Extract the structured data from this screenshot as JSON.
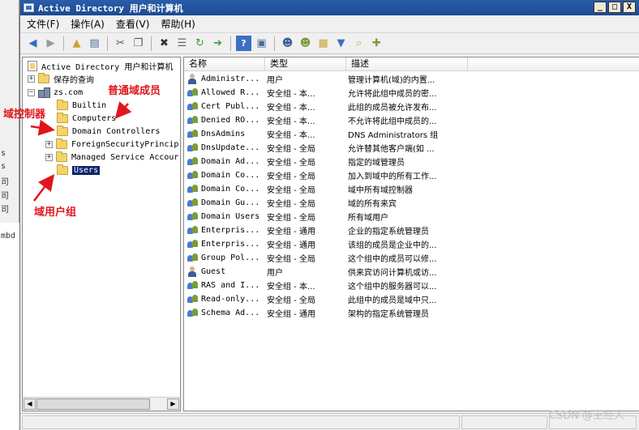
{
  "window": {
    "title": "Active Directory 用户和计算机",
    "min_label": "_",
    "max_label": "□",
    "close_label": "X"
  },
  "left_fragment": {
    "lines": [
      "s",
      "s",
      "司",
      "司",
      "司",
      "mbd"
    ]
  },
  "menu": {
    "items": [
      "文件(F)",
      "操作(A)",
      "查看(V)",
      "帮助(H)"
    ]
  },
  "toolbar": {
    "icons": [
      "back-icon",
      "forward-icon",
      "up-folder-icon",
      "show-tree-icon",
      "cut-icon",
      "copy-icon",
      "delete-icon",
      "properties-icon",
      "refresh-icon",
      "export-icon",
      "help-icon",
      "console-icon",
      "new-user-icon",
      "new-group-icon",
      "new-ou-icon",
      "filter-icon",
      "find-icon",
      "add-to-group-icon"
    ]
  },
  "tree": {
    "items": [
      {
        "label": "Active Directory 用户和计算机",
        "expander": "",
        "icon": "root"
      },
      {
        "label": "保存的查询",
        "expander": "+",
        "icon": "folder"
      },
      {
        "label": "zs.com",
        "expander": "−",
        "icon": "domain"
      },
      {
        "label": "Builtin",
        "expander": "",
        "icon": "folder"
      },
      {
        "label": "Computers",
        "expander": "",
        "icon": "folder"
      },
      {
        "label": "Domain Controllers",
        "expander": "",
        "icon": "folder"
      },
      {
        "label": "ForeignSecurityPrincip",
        "expander": "+",
        "icon": "folder"
      },
      {
        "label": "Managed Service Accour",
        "expander": "+",
        "icon": "folder"
      },
      {
        "label": "Users",
        "expander": "",
        "icon": "folder",
        "selected": true
      }
    ],
    "scroll_left": "◀",
    "scroll_right": "▶"
  },
  "list": {
    "headers": [
      "名称",
      "类型",
      "描述"
    ],
    "rows": [
      {
        "icon": "user",
        "name": "Administr...",
        "type": "用户",
        "desc": "管理计算机(域)的内置..."
      },
      {
        "icon": "group",
        "name": "Allowed R...",
        "type": "安全组 - 本...",
        "desc": "允许将此组中成员的密..."
      },
      {
        "icon": "group",
        "name": "Cert Publ...",
        "type": "安全组 - 本...",
        "desc": "此组的成员被允许发布..."
      },
      {
        "icon": "group",
        "name": "Denied RO...",
        "type": "安全组 - 本...",
        "desc": "不允许将此组中成员的..."
      },
      {
        "icon": "group",
        "name": "DnsAdmins",
        "type": "安全组 - 本...",
        "desc": "DNS Administrators 组"
      },
      {
        "icon": "group",
        "name": "DnsUpdate...",
        "type": "安全组 - 全局",
        "desc": "允许替其他客户端(如 ..."
      },
      {
        "icon": "group",
        "name": "Domain Ad...",
        "type": "安全组 - 全局",
        "desc": "指定的域管理员"
      },
      {
        "icon": "group",
        "name": "Domain Co...",
        "type": "安全组 - 全局",
        "desc": "加入到域中的所有工作..."
      },
      {
        "icon": "group",
        "name": "Domain Co...",
        "type": "安全组 - 全局",
        "desc": "域中所有域控制器"
      },
      {
        "icon": "group",
        "name": "Domain Gu...",
        "type": "安全组 - 全局",
        "desc": "域的所有来宾"
      },
      {
        "icon": "group",
        "name": "Domain Users",
        "type": "安全组 - 全局",
        "desc": "所有域用户"
      },
      {
        "icon": "group",
        "name": "Enterpris...",
        "type": "安全组 - 通用",
        "desc": "企业的指定系统管理员"
      },
      {
        "icon": "group",
        "name": "Enterpris...",
        "type": "安全组 - 通用",
        "desc": "该组的成员是企业中的..."
      },
      {
        "icon": "group",
        "name": "Group Pol...",
        "type": "安全组 - 全局",
        "desc": "这个组中的成员可以修..."
      },
      {
        "icon": "user",
        "name": "Guest",
        "type": "用户",
        "desc": "供来宾访问计算机或访..."
      },
      {
        "icon": "group",
        "name": "RAS and I...",
        "type": "安全组 - 本...",
        "desc": "这个组中的服务器可以..."
      },
      {
        "icon": "group",
        "name": "Read-only...",
        "type": "安全组 - 全局",
        "desc": "此组中的成员是域中只..."
      },
      {
        "icon": "group",
        "name": "Schema Ad...",
        "type": "安全组 - 通用",
        "desc": "架构的指定系统管理员"
      }
    ]
  },
  "annotations": {
    "member": "普通域成员",
    "dc": "域控制器",
    "usergroup": "域用户组",
    "color": "#e0161d"
  },
  "watermark": "CSDN @王经人"
}
